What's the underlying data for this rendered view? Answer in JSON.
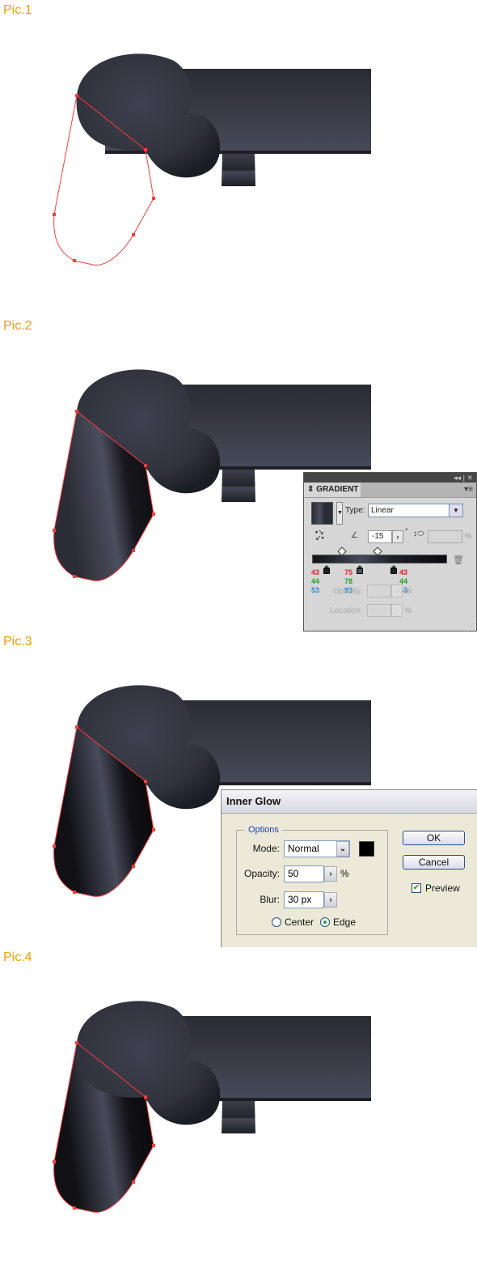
{
  "labels": [
    "Pic.1",
    "Pic.2",
    "Pic.3",
    "Pic.4"
  ],
  "colors": {
    "label": "#f0a000",
    "path_stroke": "#ff3b3b",
    "shape_dark": "#2b2c35",
    "shape_light": "#474a59"
  },
  "gradient_panel": {
    "title": "GRADIENT",
    "header_controls": "◂◂ | ✕",
    "menu_icon": "▾≡",
    "type_label": "Type:",
    "type_value": "Linear",
    "angle_value": "-15",
    "degree_symbol": "°",
    "aspect_pct": "%",
    "stops": [
      {
        "r": "43",
        "g": "44",
        "b": "53"
      },
      {
        "r": "75",
        "g": "78",
        "b": "93"
      },
      {
        "r": "43",
        "g": "44",
        "b": "53"
      }
    ],
    "opacity_label": "Opacity:",
    "location_label": "Location:",
    "opacity_pct": "%",
    "location_pct": "%"
  },
  "inner_glow": {
    "title": "Inner Glow",
    "options_legend": "Options",
    "mode_label": "Mode:",
    "mode_value": "Normal",
    "opacity_label": "Opacity:",
    "opacity_value": "50",
    "opacity_unit": "%",
    "blur_label": "Blur:",
    "blur_value": "30 px",
    "center_label": "Center",
    "edge_label": "Edge",
    "selected_source": "Edge",
    "ok_label": "OK",
    "cancel_label": "Cancel",
    "preview_label": "Preview",
    "preview_checked": true
  }
}
